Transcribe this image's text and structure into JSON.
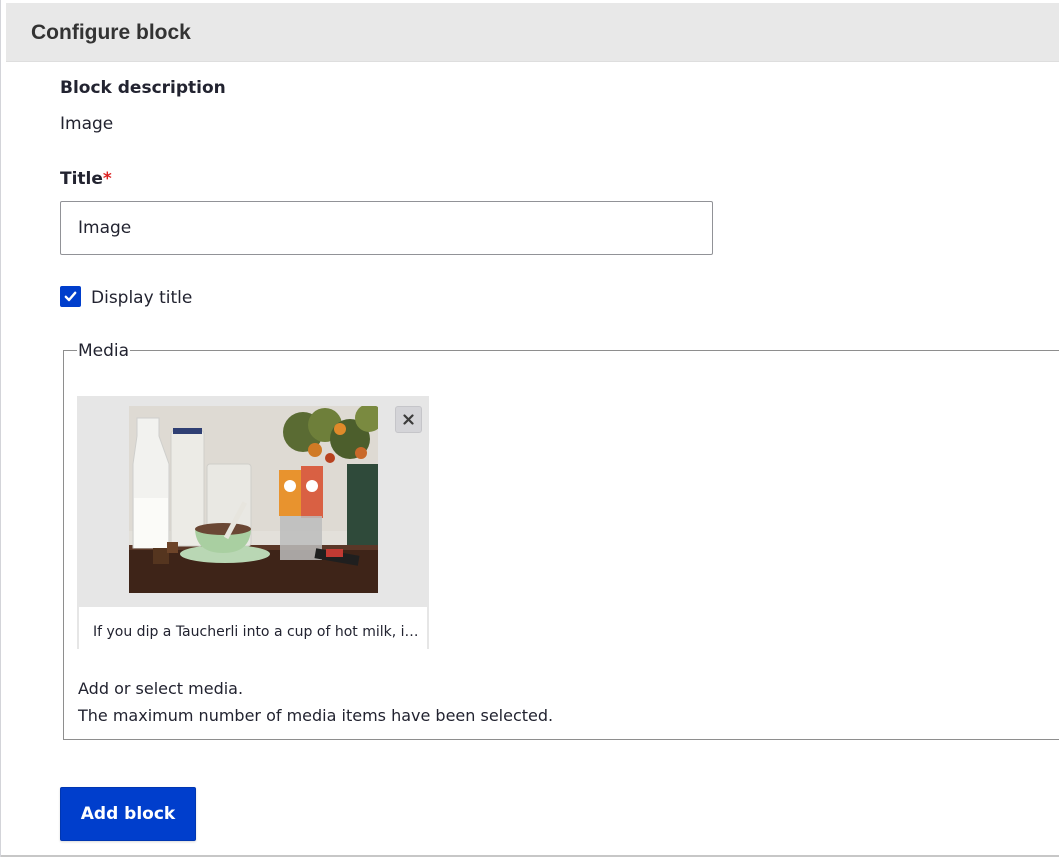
{
  "dialog": {
    "title": "Configure block"
  },
  "form": {
    "block_description": {
      "label": "Block description",
      "value": "Image"
    },
    "title": {
      "label": "Title",
      "required_marker": "*",
      "value": "Image"
    },
    "display_title": {
      "label": "Display title",
      "checked": true
    },
    "media": {
      "legend": "Media",
      "item": {
        "caption": "If you dip a Taucherli into a cup of hot milk, it t…",
        "remove_icon": "close-icon"
      },
      "help_text": "Add or select media.",
      "status_text": "The maximum number of media items have been selected."
    },
    "submit": {
      "label": "Add block"
    }
  },
  "colors": {
    "accent": "#003ecc",
    "header_bg": "#e8e8e8",
    "required": "#dc2323",
    "text": "#222330"
  }
}
